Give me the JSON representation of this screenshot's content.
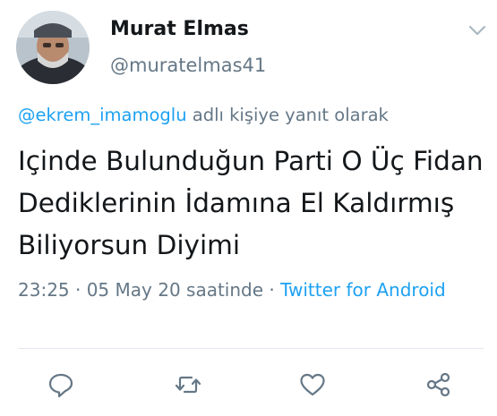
{
  "tweet": {
    "display_name": "Murat Elmas",
    "handle": "@muratelmas41",
    "reply_to": {
      "mention": "@ekrem_imamoglu",
      "suffix": " adlı kişiye yanıt olarak"
    },
    "text": "Içinde Bulunduğun Parti O Üç Fidan Dediklerinin İdamına El Kaldırmış Biliyorsun Diyimi",
    "time": "23:25 · 05 May 20 saatinde · ",
    "source": "Twitter for Android"
  },
  "icons": {
    "menu": "chevron-down-icon",
    "reply": "reply-icon",
    "retweet": "retweet-icon",
    "like": "heart-icon",
    "share": "share-icon"
  },
  "colors": {
    "link": "#1da1f2",
    "secondary_text": "#657786",
    "primary_text": "#14171a",
    "divider": "#e1e8ed"
  }
}
